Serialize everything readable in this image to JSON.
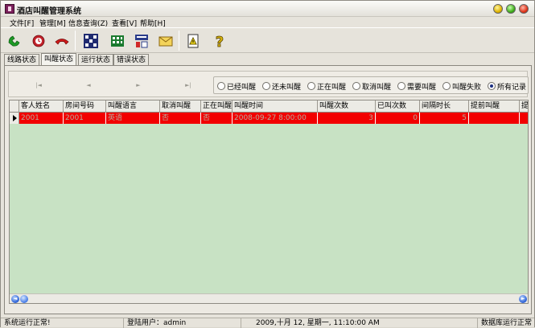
{
  "window": {
    "title": "酒店叫醒管理系统"
  },
  "menu": [
    "文件[F]",
    "管理[M]",
    "信息查询(Z)",
    "查看[V]",
    "帮助[H]"
  ],
  "toolbar": [
    {
      "icon": "phone-answer-icon",
      "color": "#1d9a25"
    },
    {
      "icon": "alarm-phone-icon",
      "color": "#c2222a"
    },
    {
      "icon": "phone-hangup-icon",
      "color": "#d01b1b"
    },
    {
      "icon": "network-grid-icon",
      "color": "#1f2a70"
    },
    {
      "icon": "database-grid-icon",
      "color": "#1a7a2e"
    },
    {
      "icon": "registry-icon",
      "color": "#2a3c8a"
    },
    {
      "icon": "mail-icon",
      "color": "#d6a21b"
    },
    {
      "icon": "notice-icon",
      "color": "#d8c01c"
    },
    {
      "icon": "help-icon",
      "color": "#d8b40c"
    }
  ],
  "tabs": [
    "线路状态",
    "叫醒状态",
    "运行状态",
    "错误状态"
  ],
  "active_tab": 1,
  "nav": [
    "|◄",
    "◄",
    "►",
    "►|"
  ],
  "filters": [
    {
      "label": "已经叫醒",
      "selected": false
    },
    {
      "label": "还未叫醒",
      "selected": false
    },
    {
      "label": "正在叫醒",
      "selected": false
    },
    {
      "label": "取消叫醒",
      "selected": false
    },
    {
      "label": "需要叫醒",
      "selected": false
    },
    {
      "label": "叫醒失败",
      "selected": false
    },
    {
      "label": "所有记录",
      "selected": true
    }
  ],
  "grid": {
    "columns": [
      "客人姓名",
      "房间号码",
      "叫醒语言",
      "取消叫醒",
      "正在叫醒",
      "叫醒时间",
      "叫醒次数",
      "已叫次数",
      "间隔时长",
      "提前叫醒",
      "提前"
    ],
    "rows": [
      [
        "2001",
        "2001",
        "英语",
        "否",
        "否",
        "2008-09-27 8:00:00",
        "3",
        "0",
        "5",
        "",
        ""
      ]
    ],
    "selected_row_color": "#f20000"
  },
  "status": {
    "system": "系统运行正常!",
    "user": "登陆用户：admin",
    "datetime": "2009,十月 12, 星期一, 11:10:00 AM",
    "db": "数据库运行正常"
  }
}
